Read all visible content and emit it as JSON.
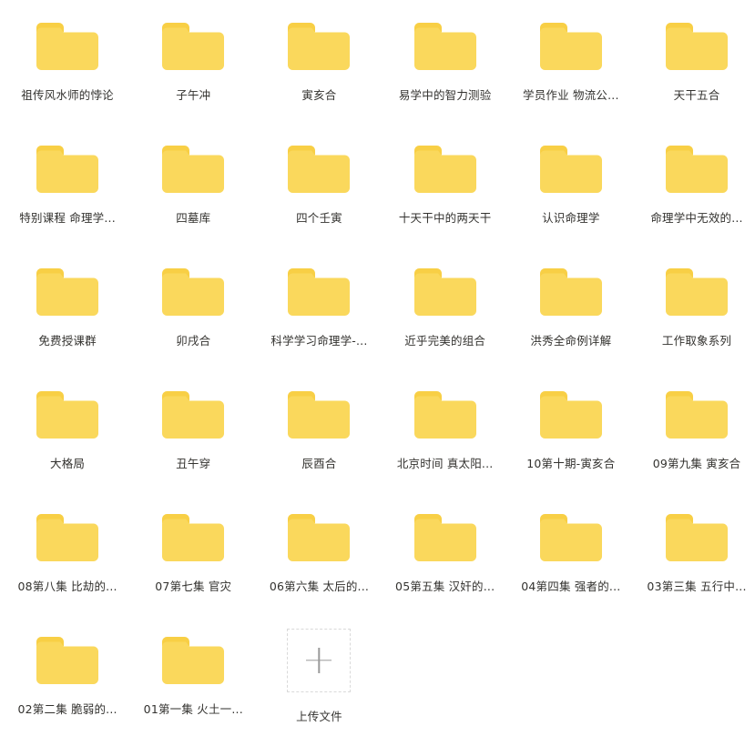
{
  "page": {
    "background_color": "#ffffff",
    "folder_color": "#fad85c",
    "folder_tab_color": "#f8cf45",
    "label_color": "#33322f",
    "upload_border_color": "#d9d9d9",
    "plus_color": "#9a9a9a",
    "columns": 6
  },
  "grid": {
    "items": [
      {
        "icon": "folder-icon",
        "label": "祖传风水师的悖论"
      },
      {
        "icon": "folder-icon",
        "label": "子午冲"
      },
      {
        "icon": "folder-icon",
        "label": "寅亥合"
      },
      {
        "icon": "folder-icon",
        "label": "易学中的智力测验"
      },
      {
        "icon": "folder-icon",
        "label": "学员作业 物流公..."
      },
      {
        "icon": "folder-icon",
        "label": "天干五合"
      },
      {
        "icon": "folder-icon",
        "label": "特别课程 命理学..."
      },
      {
        "icon": "folder-icon",
        "label": "四墓库"
      },
      {
        "icon": "folder-icon",
        "label": "四个壬寅"
      },
      {
        "icon": "folder-icon",
        "label": "十天干中的两天干"
      },
      {
        "icon": "folder-icon",
        "label": "认识命理学"
      },
      {
        "icon": "folder-icon",
        "label": "命理学中无效的..."
      },
      {
        "icon": "folder-icon",
        "label": "免费授课群"
      },
      {
        "icon": "folder-icon",
        "label": "卯戌合"
      },
      {
        "icon": "folder-icon",
        "label": "科学学习命理学-..."
      },
      {
        "icon": "folder-icon",
        "label": "近乎完美的组合"
      },
      {
        "icon": "folder-icon",
        "label": "洪秀全命例详解"
      },
      {
        "icon": "folder-icon",
        "label": "工作取象系列"
      },
      {
        "icon": "folder-icon",
        "label": "大格局"
      },
      {
        "icon": "folder-icon",
        "label": "丑午穿"
      },
      {
        "icon": "folder-icon",
        "label": "辰酉合"
      },
      {
        "icon": "folder-icon",
        "label": "北京时间 真太阳..."
      },
      {
        "icon": "folder-icon",
        "label": "10第十期-寅亥合"
      },
      {
        "icon": "folder-icon",
        "label": "09第九集 寅亥合"
      },
      {
        "icon": "folder-icon",
        "label": "08第八集 比劫的..."
      },
      {
        "icon": "folder-icon",
        "label": "07第七集 官灾"
      },
      {
        "icon": "folder-icon",
        "label": "06第六集 太后的..."
      },
      {
        "icon": "folder-icon",
        "label": "05第五集 汉奸的..."
      },
      {
        "icon": "folder-icon",
        "label": "04第四集 强者的..."
      },
      {
        "icon": "folder-icon",
        "label": "03第三集 五行中..."
      },
      {
        "icon": "folder-icon",
        "label": "02第二集 脆弱的..."
      },
      {
        "icon": "folder-icon",
        "label": "01第一集 火土一..."
      }
    ]
  },
  "upload": {
    "icon": "plus-icon",
    "label": "上传文件"
  }
}
